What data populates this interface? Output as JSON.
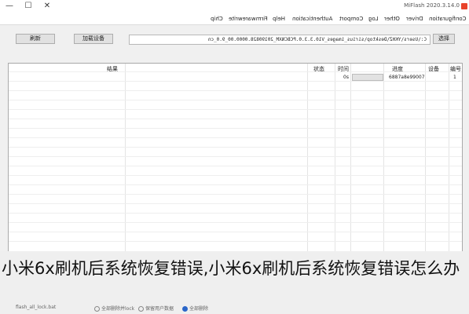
{
  "window": {
    "title": "MiFlash 2020.3.14.0",
    "minimize_glyph": "—",
    "maximize_glyph": "☐",
    "close_glyph": "✕"
  },
  "menu": {
    "items": [
      "Configuration",
      "Driver",
      "Other",
      "Log",
      "Comport",
      "Authentication",
      "Help",
      "Firmwarewrite",
      "Chip"
    ]
  },
  "toolbar": {
    "refresh_label": "刷新",
    "load_device_label": "加载设备",
    "select_label": "选择",
    "path_value": "C:\\Users\\YKHZ\\Desktop\\sirius_images_V10.3.3.0.PCBCNXM_20190828.0000.00_9.0_cn"
  },
  "table": {
    "headers": [
      "编号",
      "设备",
      "进度",
      "时间",
      "状态",
      "结果"
    ],
    "rows": [
      {
        "num": "1",
        "device": "6887a8e99007",
        "progress": 0.0,
        "time": "0s",
        "status": "",
        "result": ""
      }
    ]
  },
  "caption": {
    "text": "小米6x刷机后系统恢复错误,小米6x刷机后系统恢复错误怎么办"
  },
  "bottom": {
    "options": [
      {
        "label": "全部删除并lock",
        "selected": false
      },
      {
        "label": "保留用户数据",
        "selected": false
      },
      {
        "label": "全部删除",
        "selected": true
      }
    ],
    "script_label": "flash_all_lock.bat"
  }
}
